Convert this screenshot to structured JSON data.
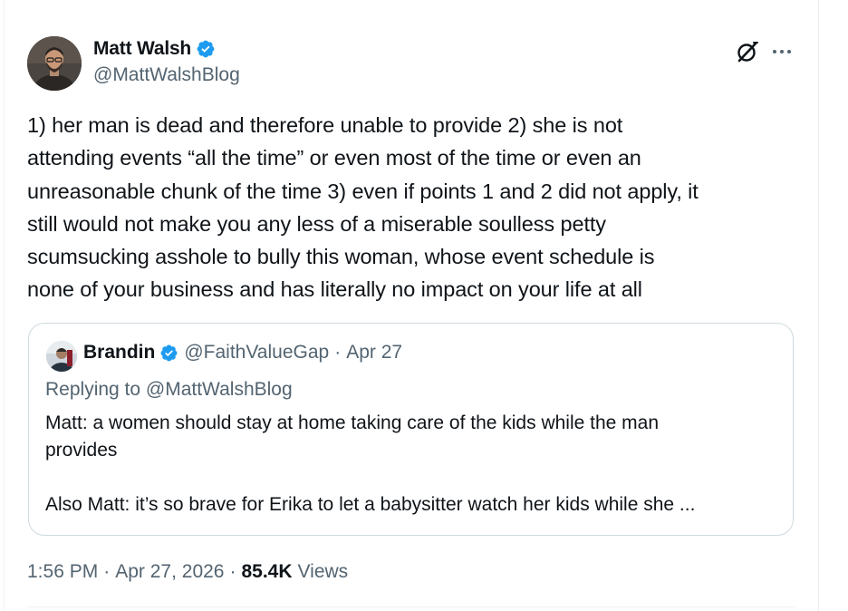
{
  "tweet": {
    "author": {
      "name": "Matt Walsh",
      "handle": "@MattWalshBlog",
      "verified": true
    },
    "text": "1) her man is dead and therefore unable to provide 2) she is not\nattending events “all the time” or even most of the time or even an\nunreasonable chunk of the time 3) even if points 1 and 2 did not apply, it\nstill would not make you any less of a miserable soulless petty\nscumsucking asshole to bully this woman, whose event schedule is\nnone of your business and has literally no impact on your life at all",
    "quoted": {
      "name": "Brandin",
      "handle": "@FaithValueGap",
      "separator": "·",
      "date": "Apr 27",
      "replying_to": "Replying to @MattWalshBlog",
      "text": "Matt: a women should stay at home taking care of the kids while the man\nprovides\n\nAlso Matt: it’s so brave for Erika to let a babysitter watch her kids while she ..."
    },
    "meta": {
      "time": "1:56 PM",
      "date": "Apr 27, 2026",
      "separator": "·",
      "views_count": "85.4K",
      "views_label": "Views"
    }
  },
  "icons": {
    "verified": "verified-badge-icon",
    "grok": "grok-icon",
    "more": "more-icon"
  },
  "colors": {
    "verified": "#1d9bf0",
    "text": "#0f1419",
    "secondary": "#536471",
    "border": "#cfd9de"
  }
}
